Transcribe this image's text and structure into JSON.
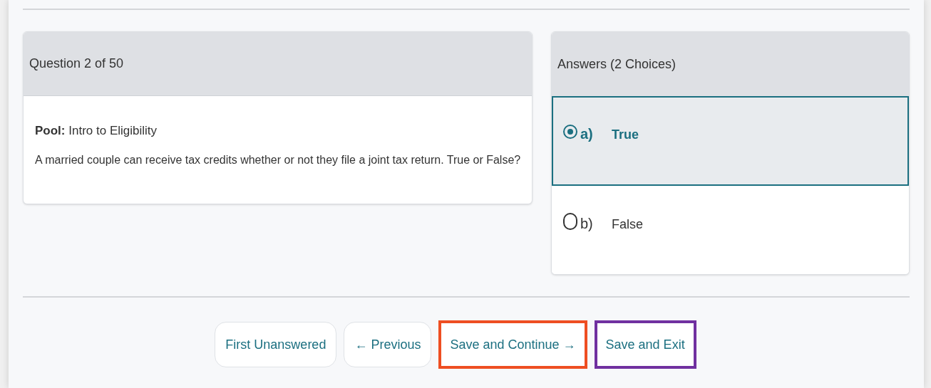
{
  "question": {
    "header": "Question 2 of 50",
    "pool_label": "Pool:",
    "pool": "Intro to Eligibility",
    "text": "A married couple can receive tax credits whether or not they file a joint tax return. True or False?"
  },
  "answers": {
    "header": "Answers (2 Choices)",
    "options": [
      {
        "letter": "a)",
        "label": "True",
        "selected": true
      },
      {
        "letter": "b)",
        "label": "False",
        "selected": false
      }
    ]
  },
  "buttons": [
    {
      "label": "First Unanswered"
    },
    {
      "label": "← Previous"
    },
    {
      "label": "Save and Continue →",
      "color": "#ee4e22"
    },
    {
      "label": "Save and Exit",
      "color": "#7030a0"
    }
  ]
}
